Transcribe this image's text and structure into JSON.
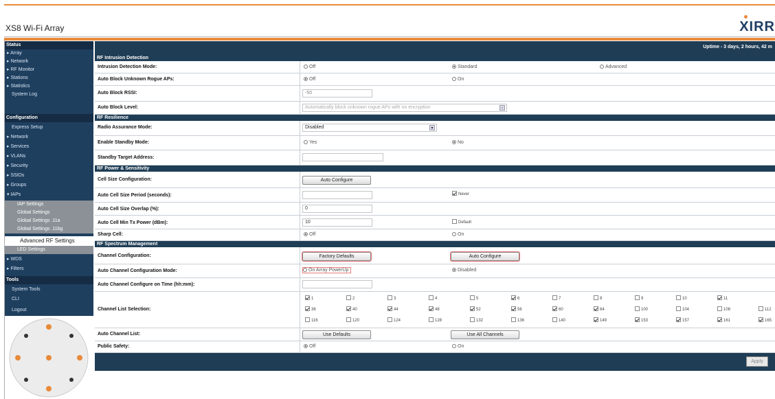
{
  "header": {
    "app_title": "XS8 Wi-Fi Array",
    "logo": "XIRR"
  },
  "topbar": {
    "uptime": "Uptime - 3 days, 2 hours, 42 m"
  },
  "sidebar": {
    "status": "Status",
    "status_items": [
      "Array",
      "Network",
      "RF Monitor",
      "Stations",
      "Statistics",
      "System Log"
    ],
    "configuration": "Configuration",
    "config_items": [
      "Express Setup",
      "Network",
      "Services",
      "VLANs",
      "Security",
      "SSIDs",
      "Groups",
      "IAPs"
    ],
    "iap_subitems": [
      "IAP Settings",
      "Global Settings",
      "Global Settings .11a",
      "Global Settings .11bg"
    ],
    "active_item": "Advanced RF Settings",
    "after_active": "LED Settings",
    "more_items": [
      "WDS",
      "Filters"
    ],
    "tools": "Tools",
    "tools_items": [
      "System Tools",
      "CLI",
      "Logout"
    ]
  },
  "colors": {
    "nav": "#1f3f5f",
    "accent": "#e88a3a",
    "logo": "#1f3d63"
  },
  "sections": {
    "intrusion": "RF Intrusion Detection",
    "resilience": "RF Resilience",
    "power": "RF Power & Sensitivity",
    "spectrum": "RF Spectrum Management"
  },
  "rows": {
    "intrusion_mode": {
      "label": "Intrusion Detection Mode:",
      "opt1": "Off",
      "opt2": "Standard",
      "opt3": "Advanced",
      "selected": "Standard"
    },
    "auto_block_rogue": {
      "label": "Auto Block Unknown Rogue APs:",
      "opt1": "Off",
      "opt2": "On",
      "selected": "Off"
    },
    "auto_block_rssi": {
      "label": "Auto Block RSSI:",
      "value": "-50"
    },
    "auto_block_level": {
      "label": "Auto Block Level:",
      "value": "Automatically block unknown rogue APs with no encryption"
    },
    "radio_assurance": {
      "label": "Radio Assurance Mode:",
      "value": "Disabled"
    },
    "standby_mode": {
      "label": "Enable Standby Mode:",
      "opt1": "Yes",
      "opt2": "No",
      "selected": "No"
    },
    "standby_target": {
      "label": "Standby Target Address:",
      "value": ""
    },
    "cell_size_config": {
      "label": "Cell Size Configuration:",
      "button": "Auto Configure"
    },
    "auto_cell_period": {
      "label": "Auto Cell Size Period (seconds):",
      "value": "",
      "check": "Never",
      "checked": true
    },
    "auto_cell_overlap": {
      "label": "Auto Cell Size Overlap (%):",
      "value": "0"
    },
    "auto_cell_min_tx": {
      "label": "Auto Cell Min Tx Power (dBm):",
      "value": "10",
      "check": "Default",
      "checked": false
    },
    "sharp_cell": {
      "label": "Sharp Cell:",
      "opt1": "Off",
      "opt2": "On",
      "selected": "Off"
    },
    "channel_config": {
      "label": "Channel Configuration:",
      "btn1": "Factory Defaults",
      "btn2": "Auto Configure"
    },
    "auto_channel_mode": {
      "label": "Auto Channel Configuration Mode:",
      "opt1": "On Array PowerUp",
      "opt2": "Disabled",
      "selected": "Disabled"
    },
    "auto_channel_time": {
      "label": "Auto Channel Configure on Time (hh:mm):",
      "value": ""
    },
    "channel_list": {
      "label": "Channel List Selection:"
    },
    "auto_channel_list": {
      "label": "Auto Channel List:",
      "btn1": "Use Defaults",
      "btn2": "Use All Channels"
    },
    "public_safety": {
      "label": "Public Safety:",
      "opt1": "Off",
      "opt2": "On",
      "selected": "Off"
    }
  },
  "channels": {
    "row1": [
      {
        "n": "1",
        "c": true
      },
      {
        "n": "2",
        "c": false
      },
      {
        "n": "3",
        "c": false
      },
      {
        "n": "4",
        "c": false
      },
      {
        "n": "5",
        "c": false
      },
      {
        "n": "6",
        "c": true
      },
      {
        "n": "7",
        "c": false
      },
      {
        "n": "8",
        "c": false
      },
      {
        "n": "9",
        "c": false
      },
      {
        "n": "10",
        "c": false
      },
      {
        "n": "11",
        "c": true
      }
    ],
    "row2": [
      {
        "n": "36",
        "c": true
      },
      {
        "n": "40",
        "c": true
      },
      {
        "n": "44",
        "c": true
      },
      {
        "n": "48",
        "c": true
      },
      {
        "n": "52",
        "c": true
      },
      {
        "n": "56",
        "c": true
      },
      {
        "n": "60",
        "c": true
      },
      {
        "n": "64",
        "c": true
      },
      {
        "n": "100",
        "c": false
      },
      {
        "n": "104",
        "c": false
      },
      {
        "n": "108",
        "c": false
      },
      {
        "n": "112",
        "c": false
      }
    ],
    "row3": [
      {
        "n": "116",
        "c": false
      },
      {
        "n": "120",
        "c": false
      },
      {
        "n": "124",
        "c": false
      },
      {
        "n": "128",
        "c": false
      },
      {
        "n": "132",
        "c": false
      },
      {
        "n": "136",
        "c": false
      },
      {
        "n": "140",
        "c": false
      },
      {
        "n": "149",
        "c": true
      },
      {
        "n": "153",
        "c": true
      },
      {
        "n": "157",
        "c": true
      },
      {
        "n": "161",
        "c": true
      },
      {
        "n": "165",
        "c": true
      }
    ]
  },
  "footer": {
    "apply": "Apply"
  }
}
